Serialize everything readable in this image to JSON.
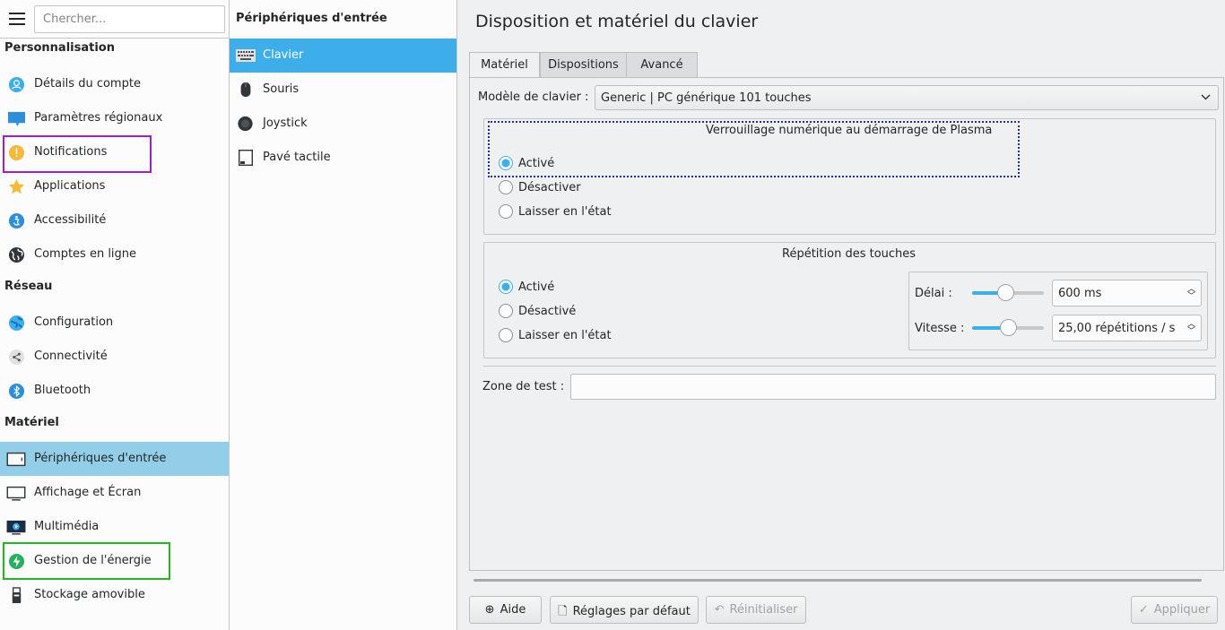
{
  "sidebar": {
    "search_placeholder": "Chercher...",
    "categories": [
      "Personnalisation",
      "Réseau",
      "Matériel"
    ],
    "items": [
      {
        "label": "Détails du compte",
        "icon": "user-account-icon"
      },
      {
        "label": "Paramètres régionaux",
        "icon": "regional-settings-icon"
      },
      {
        "label": "Notifications",
        "icon": "notifications-icon"
      },
      {
        "label": "Applications",
        "icon": "applications-star-icon"
      },
      {
        "label": "Accessibilité",
        "icon": "accessibility-icon"
      },
      {
        "label": "Comptes en ligne",
        "icon": "online-accounts-globe-icon"
      },
      {
        "label": "Configuration",
        "icon": "network-configuration-icon"
      },
      {
        "label": "Connectivité",
        "icon": "connectivity-share-icon"
      },
      {
        "label": "Bluetooth",
        "icon": "bluetooth-icon"
      },
      {
        "label": "Périphériques d'entrée",
        "icon": "input-devices-icon"
      },
      {
        "label": "Affichage et Écran",
        "icon": "display-monitor-icon"
      },
      {
        "label": "Multimédia",
        "icon": "multimedia-icon"
      },
      {
        "label": "Gestion de l'énergie",
        "icon": "power-management-icon"
      },
      {
        "label": "Stockage amovible",
        "icon": "removable-storage-icon"
      }
    ]
  },
  "subpanel": {
    "title": "Périphériques d'entrée",
    "items": [
      {
        "label": "Clavier",
        "icon": "keyboard-icon"
      },
      {
        "label": "Souris",
        "icon": "mouse-icon"
      },
      {
        "label": "Joystick",
        "icon": "joystick-icon"
      },
      {
        "label": "Pavé tactile",
        "icon": "touchpad-icon"
      }
    ]
  },
  "main": {
    "title": "Disposition et matériel du clavier",
    "tabs": [
      "Matériel",
      "Dispositions",
      "Avancé"
    ],
    "model_label": "Modèle de clavier :",
    "model_value": "Generic | PC générique 101 touches",
    "numlock": {
      "title": "Verrouillage numérique au démarrage de Plasma",
      "options": [
        "Activé",
        "Désactiver",
        "Laisser en l'état"
      ]
    },
    "repeat": {
      "title": "Répétition des touches",
      "options": [
        "Activé",
        "Désactivé",
        "Laisser en l'état"
      ],
      "delay_label": "Délai :",
      "delay_value": "600 ms",
      "speed_label": "Vitesse :",
      "speed_value": "25,00 répétitions / s"
    },
    "test_label": "Zone de test :",
    "buttons": {
      "help": "Aide",
      "defaults": "Réglages par défaut",
      "reset": "Réinitialiser",
      "apply": "Appliquer"
    }
  },
  "colors": {
    "accent": "#3daee9",
    "selection_sidebar": "#93cee9",
    "highlight_purple": "#a020c0",
    "highlight_green": "#22b822"
  }
}
